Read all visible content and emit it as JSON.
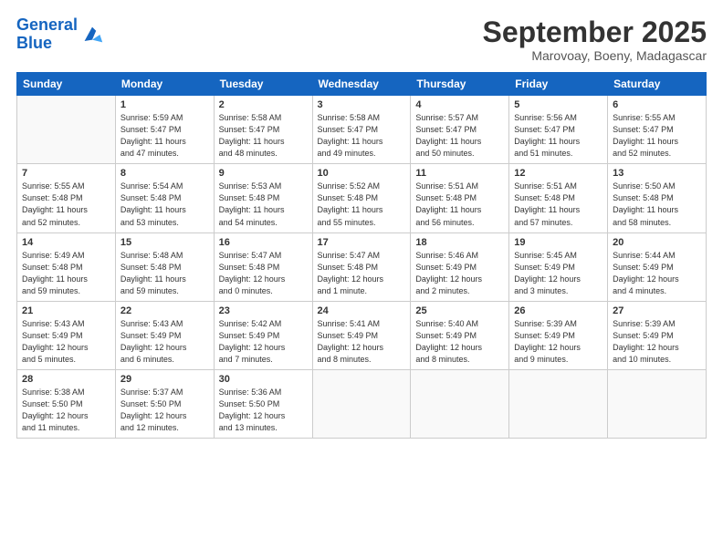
{
  "logo": {
    "line1": "General",
    "line2": "Blue"
  },
  "title": "September 2025",
  "location": "Marovoay, Boeny, Madagascar",
  "header_days": [
    "Sunday",
    "Monday",
    "Tuesday",
    "Wednesday",
    "Thursday",
    "Friday",
    "Saturday"
  ],
  "weeks": [
    [
      {
        "num": "",
        "info": ""
      },
      {
        "num": "1",
        "info": "Sunrise: 5:59 AM\nSunset: 5:47 PM\nDaylight: 11 hours\nand 47 minutes."
      },
      {
        "num": "2",
        "info": "Sunrise: 5:58 AM\nSunset: 5:47 PM\nDaylight: 11 hours\nand 48 minutes."
      },
      {
        "num": "3",
        "info": "Sunrise: 5:58 AM\nSunset: 5:47 PM\nDaylight: 11 hours\nand 49 minutes."
      },
      {
        "num": "4",
        "info": "Sunrise: 5:57 AM\nSunset: 5:47 PM\nDaylight: 11 hours\nand 50 minutes."
      },
      {
        "num": "5",
        "info": "Sunrise: 5:56 AM\nSunset: 5:47 PM\nDaylight: 11 hours\nand 51 minutes."
      },
      {
        "num": "6",
        "info": "Sunrise: 5:55 AM\nSunset: 5:47 PM\nDaylight: 11 hours\nand 52 minutes."
      }
    ],
    [
      {
        "num": "7",
        "info": "Sunrise: 5:55 AM\nSunset: 5:48 PM\nDaylight: 11 hours\nand 52 minutes."
      },
      {
        "num": "8",
        "info": "Sunrise: 5:54 AM\nSunset: 5:48 PM\nDaylight: 11 hours\nand 53 minutes."
      },
      {
        "num": "9",
        "info": "Sunrise: 5:53 AM\nSunset: 5:48 PM\nDaylight: 11 hours\nand 54 minutes."
      },
      {
        "num": "10",
        "info": "Sunrise: 5:52 AM\nSunset: 5:48 PM\nDaylight: 11 hours\nand 55 minutes."
      },
      {
        "num": "11",
        "info": "Sunrise: 5:51 AM\nSunset: 5:48 PM\nDaylight: 11 hours\nand 56 minutes."
      },
      {
        "num": "12",
        "info": "Sunrise: 5:51 AM\nSunset: 5:48 PM\nDaylight: 11 hours\nand 57 minutes."
      },
      {
        "num": "13",
        "info": "Sunrise: 5:50 AM\nSunset: 5:48 PM\nDaylight: 11 hours\nand 58 minutes."
      }
    ],
    [
      {
        "num": "14",
        "info": "Sunrise: 5:49 AM\nSunset: 5:48 PM\nDaylight: 11 hours\nand 59 minutes."
      },
      {
        "num": "15",
        "info": "Sunrise: 5:48 AM\nSunset: 5:48 PM\nDaylight: 11 hours\nand 59 minutes."
      },
      {
        "num": "16",
        "info": "Sunrise: 5:47 AM\nSunset: 5:48 PM\nDaylight: 12 hours\nand 0 minutes."
      },
      {
        "num": "17",
        "info": "Sunrise: 5:47 AM\nSunset: 5:48 PM\nDaylight: 12 hours\nand 1 minute."
      },
      {
        "num": "18",
        "info": "Sunrise: 5:46 AM\nSunset: 5:49 PM\nDaylight: 12 hours\nand 2 minutes."
      },
      {
        "num": "19",
        "info": "Sunrise: 5:45 AM\nSunset: 5:49 PM\nDaylight: 12 hours\nand 3 minutes."
      },
      {
        "num": "20",
        "info": "Sunrise: 5:44 AM\nSunset: 5:49 PM\nDaylight: 12 hours\nand 4 minutes."
      }
    ],
    [
      {
        "num": "21",
        "info": "Sunrise: 5:43 AM\nSunset: 5:49 PM\nDaylight: 12 hours\nand 5 minutes."
      },
      {
        "num": "22",
        "info": "Sunrise: 5:43 AM\nSunset: 5:49 PM\nDaylight: 12 hours\nand 6 minutes."
      },
      {
        "num": "23",
        "info": "Sunrise: 5:42 AM\nSunset: 5:49 PM\nDaylight: 12 hours\nand 7 minutes."
      },
      {
        "num": "24",
        "info": "Sunrise: 5:41 AM\nSunset: 5:49 PM\nDaylight: 12 hours\nand 8 minutes."
      },
      {
        "num": "25",
        "info": "Sunrise: 5:40 AM\nSunset: 5:49 PM\nDaylight: 12 hours\nand 8 minutes."
      },
      {
        "num": "26",
        "info": "Sunrise: 5:39 AM\nSunset: 5:49 PM\nDaylight: 12 hours\nand 9 minutes."
      },
      {
        "num": "27",
        "info": "Sunrise: 5:39 AM\nSunset: 5:49 PM\nDaylight: 12 hours\nand 10 minutes."
      }
    ],
    [
      {
        "num": "28",
        "info": "Sunrise: 5:38 AM\nSunset: 5:50 PM\nDaylight: 12 hours\nand 11 minutes."
      },
      {
        "num": "29",
        "info": "Sunrise: 5:37 AM\nSunset: 5:50 PM\nDaylight: 12 hours\nand 12 minutes."
      },
      {
        "num": "30",
        "info": "Sunrise: 5:36 AM\nSunset: 5:50 PM\nDaylight: 12 hours\nand 13 minutes."
      },
      {
        "num": "",
        "info": ""
      },
      {
        "num": "",
        "info": ""
      },
      {
        "num": "",
        "info": ""
      },
      {
        "num": "",
        "info": ""
      }
    ]
  ]
}
